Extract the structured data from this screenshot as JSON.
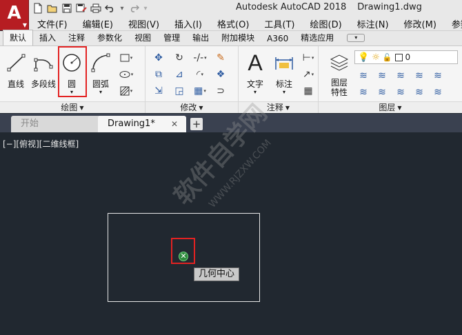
{
  "app": {
    "logo_letter": "A",
    "title": "Autodesk AutoCAD 2018",
    "document_name": "Drawing1.dwg"
  },
  "quick_access": [
    "new-icon",
    "open-icon",
    "save-icon",
    "save-as-icon",
    "print-icon",
    "undo-icon",
    "redo-icon"
  ],
  "menu": [
    "文件(F)",
    "编辑(E)",
    "视图(V)",
    "插入(I)",
    "格式(O)",
    "工具(T)",
    "绘图(D)",
    "标注(N)",
    "修改(M)",
    "参数(P)"
  ],
  "ribbon_tabs": {
    "active": "默认",
    "items": [
      "默认",
      "插入",
      "注释",
      "参数化",
      "视图",
      "管理",
      "输出",
      "附加模块",
      "A360",
      "精选应用"
    ]
  },
  "ribbon": {
    "draw": {
      "title": "绘图",
      "line": "直线",
      "polyline": "多段线",
      "circle": "圆",
      "arc": "圆弧"
    },
    "modify": {
      "title": "修改"
    },
    "annotation": {
      "title": "注释",
      "text": "文字",
      "dimension": "标注"
    },
    "layers": {
      "title": "图层",
      "layer_properties_line1": "图层",
      "layer_properties_line2": "特性",
      "current_layer": "0"
    }
  },
  "doc_tabs": {
    "start": "开始",
    "drawing": "Drawing1*",
    "close": "✕",
    "add": "+"
  },
  "canvas": {
    "viewport_label": "[−][俯视][二维线框]",
    "snap_tooltip": "几何中心"
  },
  "watermark": {
    "text": "软件自学网",
    "url": "WWW.RJZXW.COM"
  },
  "colors": {
    "logo": "#b61d22",
    "highlight": "#e32222",
    "canvas": "#212830",
    "snap": "#2e8b3d"
  }
}
